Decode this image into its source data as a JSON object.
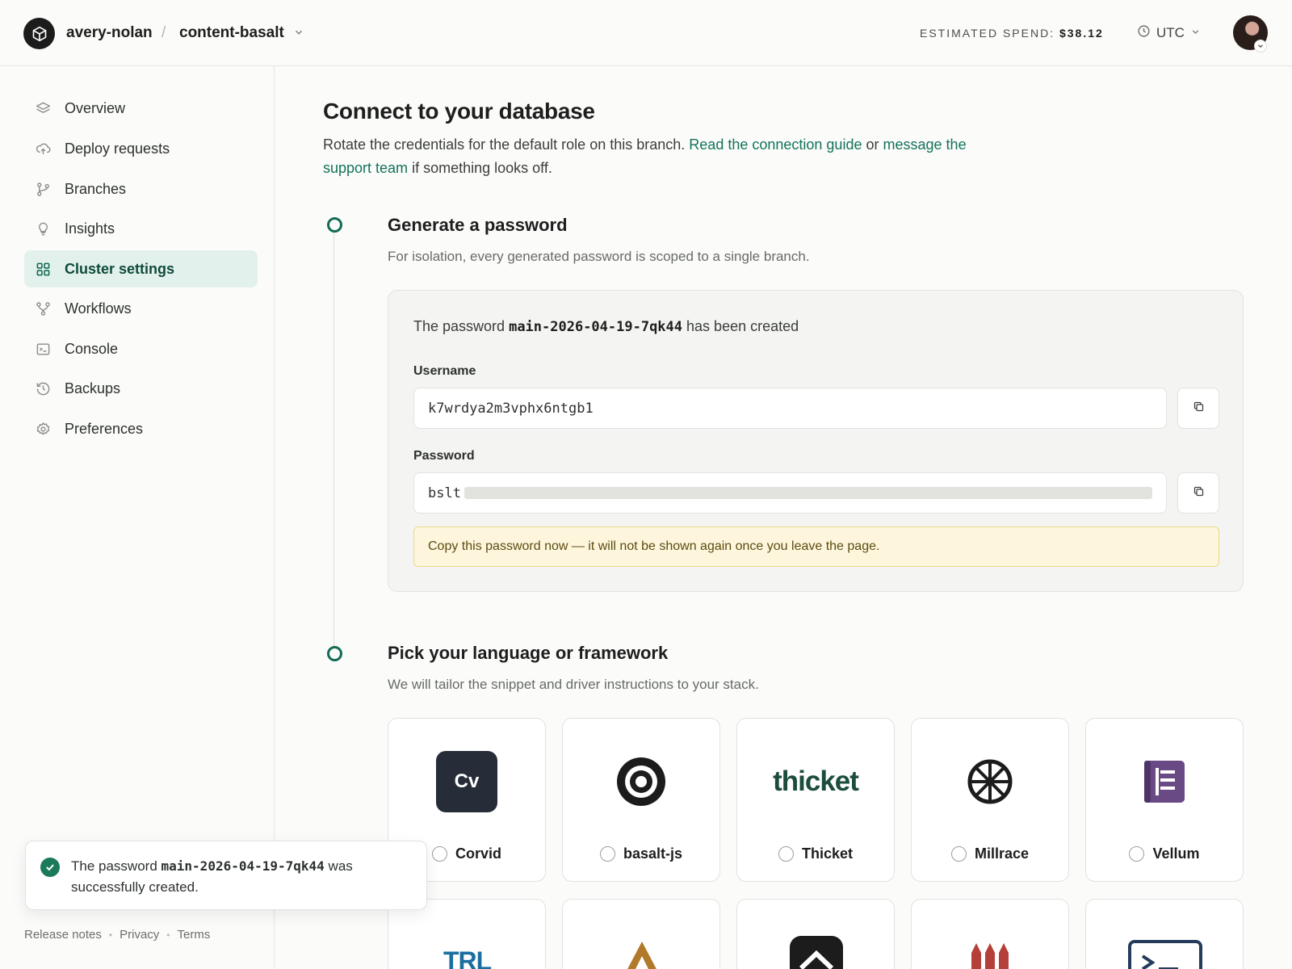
{
  "header": {
    "org": "avery-nolan",
    "separator": "/",
    "project": "content-basalt",
    "spend_label": "ESTIMATED SPEND:",
    "spend_value": "$38.12",
    "timezone": "UTC"
  },
  "sidebar": {
    "items": [
      {
        "label": "Overview",
        "icon": "layers-icon",
        "active": false
      },
      {
        "label": "Deploy requests",
        "icon": "cloud-upload-icon",
        "active": false
      },
      {
        "label": "Branches",
        "icon": "git-branch-icon",
        "active": false
      },
      {
        "label": "Insights",
        "icon": "lightbulb-icon",
        "active": false
      },
      {
        "label": "Cluster settings",
        "icon": "grid-icon",
        "active": true
      },
      {
        "label": "Workflows",
        "icon": "workflow-icon",
        "active": false
      },
      {
        "label": "Console",
        "icon": "terminal-icon",
        "active": false
      },
      {
        "label": "Backups",
        "icon": "history-icon",
        "active": false
      },
      {
        "label": "Preferences",
        "icon": "gear-icon",
        "active": false
      }
    ],
    "footer": [
      "Release notes",
      "Privacy",
      "Terms"
    ]
  },
  "toast": {
    "prefix": "The password",
    "name": "main-2026-04-19-7qk44",
    "suffix": "was successfully created."
  },
  "main": {
    "title": "Connect to your database",
    "intro_text": "Rotate the credentials for the default role on this branch.",
    "intro_link1": "Read the connection guide",
    "intro_or": "or",
    "intro_link2": "message the support team",
    "intro_end": "if something looks off.",
    "step1": {
      "title": "Generate a password",
      "subtitle": "For isolation, every generated password is scoped to a single branch.",
      "created_prefix": "The password",
      "created_name": "main-2026-04-19-7qk44",
      "created_suffix": "has been created",
      "username_label": "Username",
      "username_value": "k7wrdya2m3vphx6ntgb1",
      "password_label": "Password",
      "password_prefix": "bslt",
      "warning": "Copy this password now — it will not be shown again once you leave the page."
    },
    "step2": {
      "title": "Pick your language or framework",
      "subtitle": "We will tailor the snippet and driver instructions to your stack.",
      "frameworks": [
        {
          "label": "Corvid",
          "logo_text": "Cv"
        },
        {
          "label": "basalt-js"
        },
        {
          "label": "Thicket",
          "logo_text": "thicket"
        },
        {
          "label": "Millrace"
        },
        {
          "label": "Vellum"
        }
      ],
      "row2_logos": [
        {
          "logo_text": "TRL"
        }
      ]
    }
  },
  "colors": {
    "accent": "#136b55",
    "link": "#137359",
    "active_bg": "#e3f1ec",
    "warning_bg": "#fdf6dc"
  }
}
